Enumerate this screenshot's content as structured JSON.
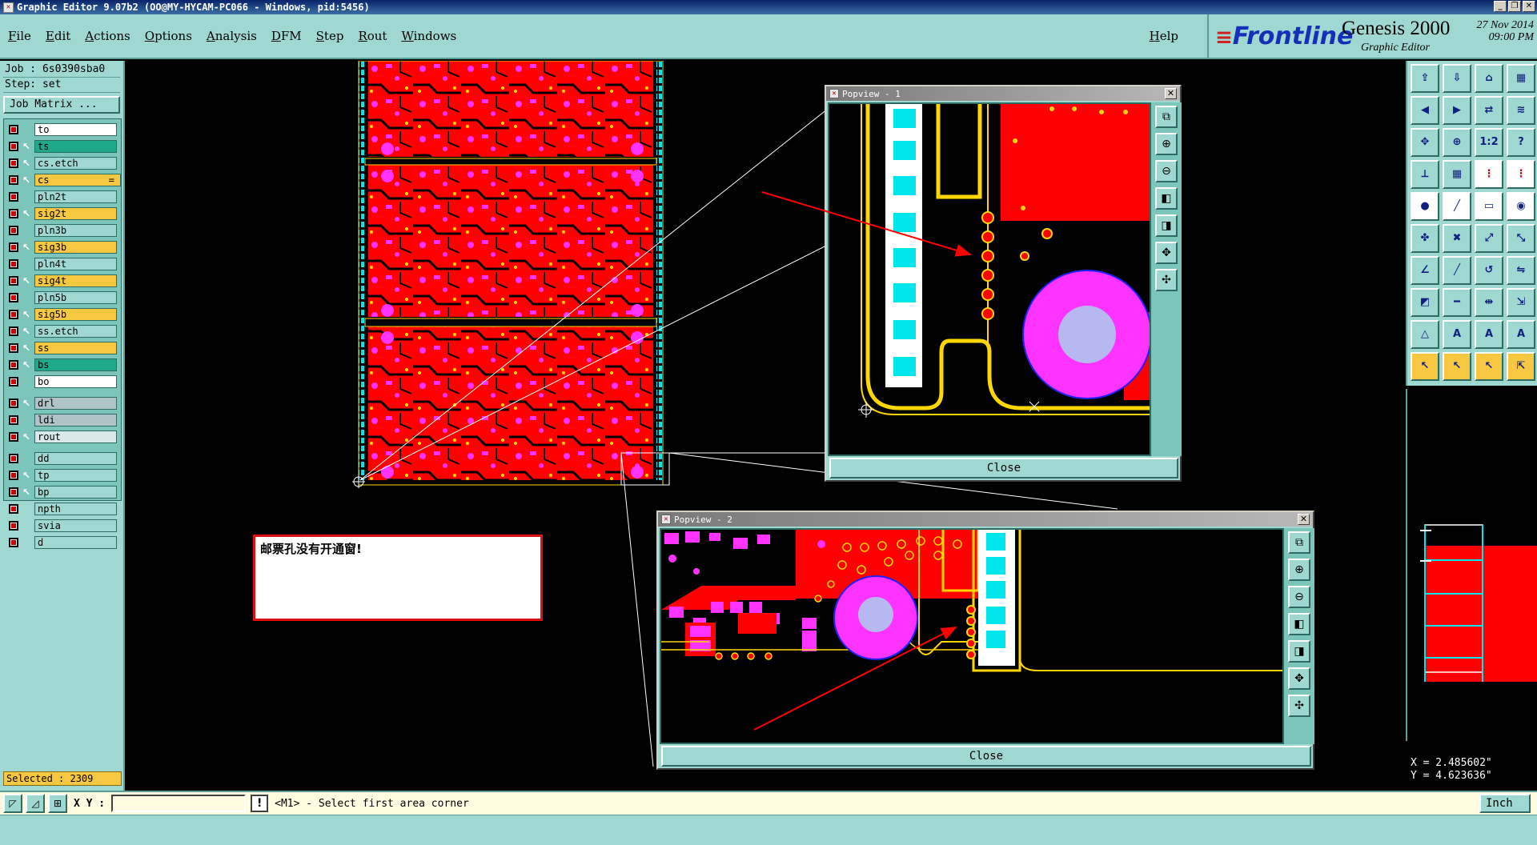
{
  "window": {
    "title": "Graphic Editor 9.07b2 (OO@MY-HYCAM-PC066 - Windows, pid:5456)",
    "controls": [
      "_",
      "❐",
      "✕"
    ]
  },
  "menu": {
    "items": [
      {
        "label": "File",
        "key": "F"
      },
      {
        "label": "Edit",
        "key": "E"
      },
      {
        "label": "Actions",
        "key": "A"
      },
      {
        "label": "Options",
        "key": "O"
      },
      {
        "label": "Analysis",
        "key": "A"
      },
      {
        "label": "DFM",
        "key": "D"
      },
      {
        "label": "Step",
        "key": "S"
      },
      {
        "label": "Rout",
        "key": "R"
      },
      {
        "label": "Windows",
        "key": "W"
      }
    ],
    "help": "Help"
  },
  "brand": {
    "logo": "Frontline",
    "product": "Genesis 2000",
    "subtitle": "Graphic Editor",
    "date": "27 Nov 2014",
    "time": "09:00 PM"
  },
  "job": {
    "job_label": "Job : 6s0390sba0",
    "step_label": "Step: set",
    "matrix_button": "Job Matrix ..."
  },
  "layers": [
    {
      "name": "to",
      "color": "#ffffff",
      "arrow": false
    },
    {
      "name": "ts",
      "color": "#1fa98a",
      "arrow": true,
      "selected": true
    },
    {
      "name": "cs.etch",
      "color": "#9fd8d0",
      "arrow": true
    },
    {
      "name": "cs",
      "color": "#f6c842",
      "arrow": true,
      "work": true,
      "marker": "="
    },
    {
      "name": "pln2t",
      "color": "#9fd8d0",
      "arrow": false
    },
    {
      "name": "sig2t",
      "color": "#f6c842",
      "arrow": true
    },
    {
      "name": "pln3b",
      "color": "#9fd8d0",
      "arrow": false
    },
    {
      "name": "sig3b",
      "color": "#f6c842",
      "arrow": true
    },
    {
      "name": "pln4t",
      "color": "#9fd8d0",
      "arrow": false
    },
    {
      "name": "sig4t",
      "color": "#f6c842",
      "arrow": true
    },
    {
      "name": "pln5b",
      "color": "#9fd8d0",
      "arrow": false
    },
    {
      "name": "sig5b",
      "color": "#f6c842",
      "arrow": true
    },
    {
      "name": "ss.etch",
      "color": "#9fd8d0",
      "arrow": true
    },
    {
      "name": "ss",
      "color": "#f6c842",
      "arrow": true
    },
    {
      "name": "bs",
      "color": "#1fa98a",
      "arrow": true
    },
    {
      "name": "bo",
      "color": "#ffffff",
      "arrow": false
    },
    {
      "name": "drl",
      "color": "#b0c4c8",
      "arrow": true,
      "gap": true
    },
    {
      "name": "ldi",
      "color": "#b0c4c8",
      "arrow": false
    },
    {
      "name": "rout",
      "color": "#d9e8e8",
      "arrow": true
    },
    {
      "name": "dd",
      "color": "#9fd8d0",
      "arrow": false,
      "gap": true
    },
    {
      "name": "tp",
      "color": "#9fd8d0",
      "arrow": true
    },
    {
      "name": "bp",
      "color": "#9fd8d0",
      "arrow": true
    },
    {
      "name": "npth",
      "color": "#9fd8d0",
      "arrow": false
    },
    {
      "name": "svia",
      "color": "#9fd8d0",
      "arrow": false
    },
    {
      "name": "d",
      "color": "#9fd8d0",
      "arrow": false
    }
  ],
  "selected_count": "Selected : 2309",
  "popview1": {
    "title": "Popview - 1",
    "close": "Close"
  },
  "popview2": {
    "title": "Popview - 2",
    "close": "Close"
  },
  "message": "邮票孔没有开通窗!",
  "coordinates": {
    "x": "X = 2.485602\"",
    "y": "Y = 4.623636\""
  },
  "status": {
    "xy_label": "X Y :",
    "input_value": "",
    "prompt": "<M1> - Select first area corner",
    "units": "Inch"
  },
  "colors": {
    "panel": "#9fd8d0",
    "copper": "#ff0000",
    "pad": "#ff33ff",
    "trace": "#ffd700",
    "cyan": "#00e5ee"
  }
}
